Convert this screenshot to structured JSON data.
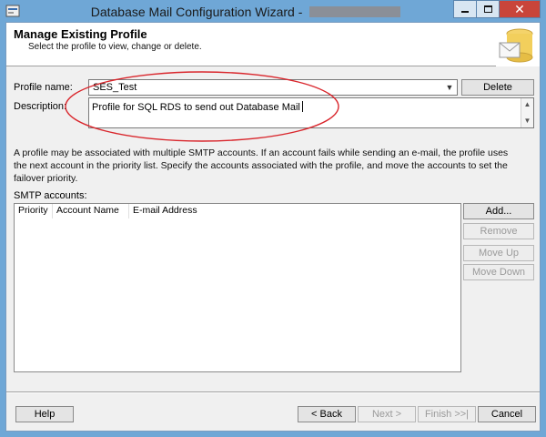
{
  "window": {
    "title": "Database Mail Configuration Wizard - ",
    "controls": {
      "minimize": "minimize-icon",
      "maximize": "maximize-icon",
      "close": "close-icon"
    }
  },
  "header": {
    "title": "Manage Existing Profile",
    "subtitle": "Select the profile to view, change or delete."
  },
  "form": {
    "profile_name_label": "Profile name:",
    "profile_name_value": "SES_Test",
    "delete_label": "Delete",
    "description_label": "Description:",
    "description_value": "Profile for SQL RDS to send out Database Mail"
  },
  "info_text": "A profile may be associated with multiple SMTP accounts. If an account fails while sending an e-mail, the profile uses the next account in the priority list. Specify the accounts associated with the profile, and move the accounts to set the failover priority.",
  "smtp": {
    "label": "SMTP accounts:",
    "columns": [
      "Priority",
      "Account Name",
      "E-mail Address"
    ],
    "rows": []
  },
  "side_buttons": {
    "add": "Add...",
    "remove": "Remove",
    "move_up": "Move Up",
    "move_down": "Move Down"
  },
  "footer": {
    "help": "Help",
    "back": "< Back",
    "next": "Next >",
    "finish": "Finish >>|",
    "cancel": "Cancel"
  },
  "colors": {
    "titlebar": "#6fa7d6",
    "annotation_circle": "#d9262c",
    "close_button": "#c9453a"
  }
}
